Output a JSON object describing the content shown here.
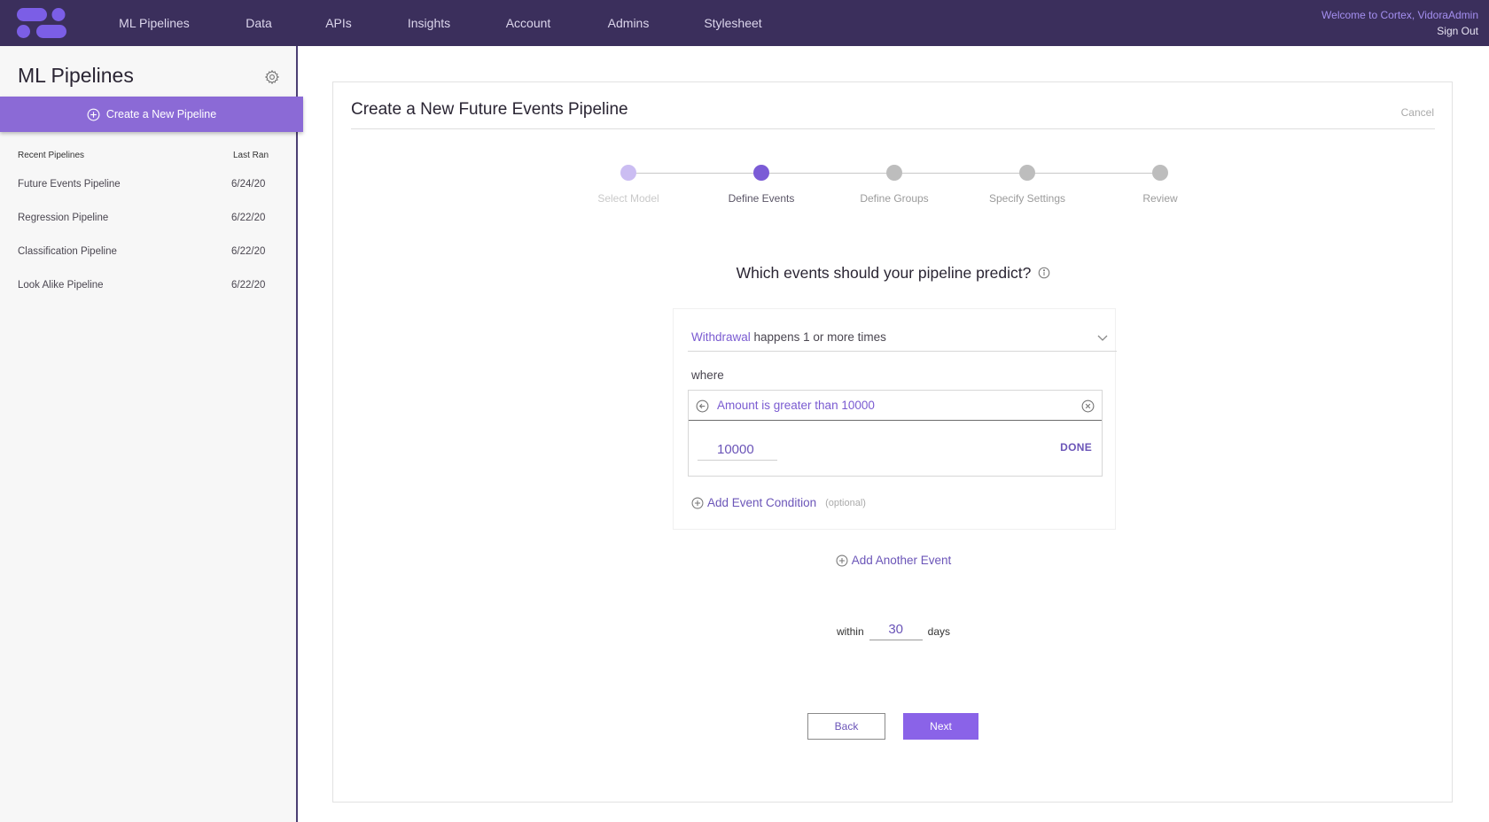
{
  "nav": {
    "tabs": [
      {
        "label": "ML Pipelines",
        "active": true
      },
      {
        "label": "Data"
      },
      {
        "label": "APIs"
      },
      {
        "label": "Insights"
      },
      {
        "label": "Account"
      },
      {
        "label": "Admins"
      },
      {
        "label": "Stylesheet"
      }
    ],
    "welcome": "Welcome to Cortex, VidoraAdmin",
    "sign_out": "Sign Out"
  },
  "sidebar": {
    "title": "ML Pipelines",
    "create_label": "Create a New Pipeline",
    "recent_header": "Recent Pipelines",
    "last_ran_header": "Last Ran",
    "pipelines": [
      {
        "name": "Future Events Pipeline",
        "date": "6/24/20"
      },
      {
        "name": "Regression Pipeline",
        "date": "6/22/20"
      },
      {
        "name": "Classification Pipeline",
        "date": "6/22/20"
      },
      {
        "name": "Look Alike Pipeline",
        "date": "6/22/20"
      }
    ]
  },
  "main": {
    "title": "Create a New Future Events Pipeline",
    "cancel": "Cancel",
    "steps": [
      {
        "label": "Select Model",
        "state": "done"
      },
      {
        "label": "Define Events",
        "state": "active"
      },
      {
        "label": "Define Groups",
        "state": "pending"
      },
      {
        "label": "Specify Settings",
        "state": "pending"
      },
      {
        "label": "Review",
        "state": "pending"
      }
    ],
    "question": "Which events should your pipeline predict?",
    "event": {
      "name": "Withdrawal",
      "rest": " happens 1 or more times",
      "where": "where",
      "condition": "Amount is greater than 10000",
      "value": "10000",
      "done": "DONE",
      "add_condition": "Add Event Condition",
      "optional": "(optional)"
    },
    "add_event": "Add Another Event",
    "within": {
      "prefix": "within",
      "value": "30",
      "suffix": "days"
    },
    "back": "Back",
    "next": "Next"
  },
  "colors": {
    "topbar": "#3b2f5c",
    "accent": "#8a63e8",
    "step_active": "#7b5bd6",
    "step_done": "#cbbdf2",
    "step_pending": "#bdbdbd"
  }
}
